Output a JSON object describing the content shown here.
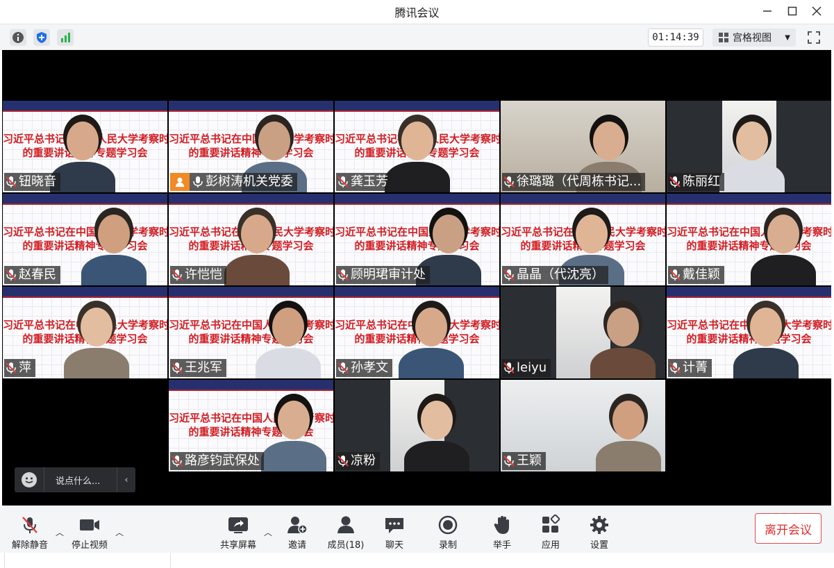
{
  "window": {
    "title": "腾讯会议"
  },
  "infobar": {
    "icons": [
      "info-icon",
      "shield-icon",
      "signal-icon"
    ],
    "timer": "01:14:39",
    "view_mode": "宫格视图",
    "fullscreen_icon": "fullscreen-icon"
  },
  "slide_text": {
    "line1": "习近平总书记在中国人民大学考察时",
    "line2": "的重要讲话精神专题学习会"
  },
  "participants": [
    {
      "name": "钮晓音",
      "mic": "muted",
      "background": "slide"
    },
    {
      "name": "彭树涛机关党委",
      "mic": "on",
      "background": "slide",
      "avatar_badge": true
    },
    {
      "name": "龚玉芳",
      "mic": "muted",
      "background": "slide"
    },
    {
      "name": "徐璐璐（代周栋书记...",
      "mic": "muted",
      "background": "room"
    },
    {
      "name": "陈丽红",
      "mic": "muted",
      "background": "dark"
    },
    {
      "name": "赵春民",
      "mic": "muted",
      "background": "slide"
    },
    {
      "name": "许恺恺",
      "mic": "muted",
      "background": "slide"
    },
    {
      "name": "顾明珺审计处",
      "mic": "muted",
      "background": "slide"
    },
    {
      "name": "晶晶（代沈亮）",
      "mic": "muted",
      "background": "slide"
    },
    {
      "name": "戴佳颖",
      "mic": "muted",
      "background": "slide"
    },
    {
      "name": "萍",
      "mic": "muted",
      "background": "slide"
    },
    {
      "name": "王兆军",
      "mic": "muted",
      "background": "slide"
    },
    {
      "name": "孙孝文",
      "mic": "muted",
      "background": "slide"
    },
    {
      "name": "leiyu",
      "mic": "muted",
      "background": "dark"
    },
    {
      "name": "计菁",
      "mic": "muted",
      "background": "slide"
    },
    {
      "name": "路彦钧武保处",
      "mic": "muted",
      "background": "slide"
    },
    {
      "name": "凉粉",
      "mic": "muted",
      "background": "dark"
    },
    {
      "name": "王颖",
      "mic": "muted",
      "background": "light"
    }
  ],
  "chat": {
    "placeholder": "说点什么..."
  },
  "toolbar": {
    "unmute": "解除静音",
    "stop_video": "停止视频",
    "share_screen": "共享屏幕",
    "invite": "邀请",
    "members": "成员(18)",
    "chat": "聊天",
    "record": "录制",
    "raise_hand": "举手",
    "apps": "应用",
    "settings": "设置",
    "leave": "离开会议"
  },
  "colors": {
    "slide_red": "#d21d22",
    "slide_header": "#27306e",
    "leave_red": "#e02e2e",
    "signal_green": "#2bb24c",
    "shield_blue": "#1f6fe5",
    "avatar_orange": "#f08a24"
  }
}
